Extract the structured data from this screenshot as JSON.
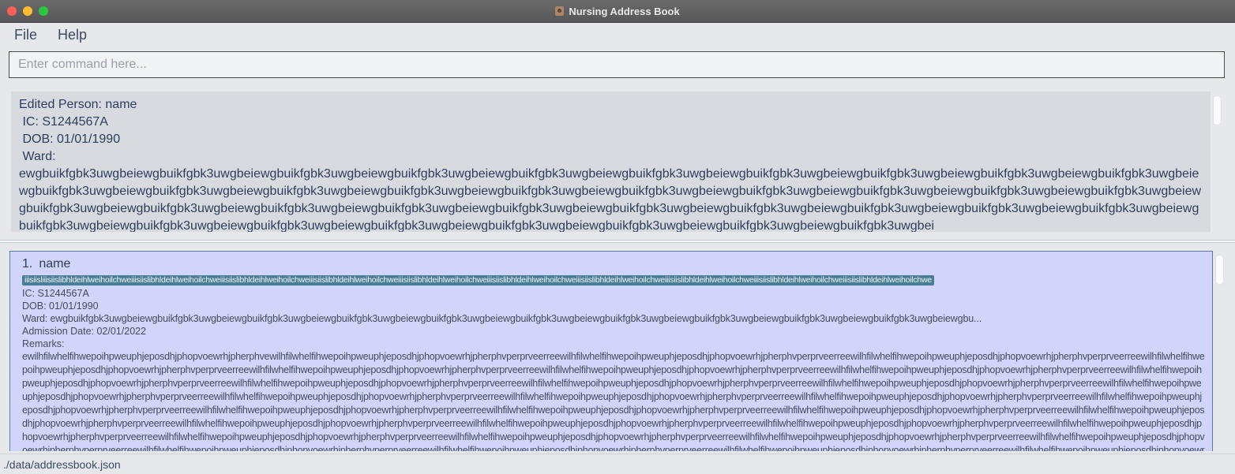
{
  "window": {
    "title": "Nursing Address Book"
  },
  "menu": {
    "file_label": "File",
    "help_label": "Help"
  },
  "command": {
    "placeholder": "Enter command here...",
    "value": ""
  },
  "result": {
    "text": "Edited Person: name\n IC: S1244567A\n DOB: 01/01/1990\n Ward: \newgbuikfgbk3uwgbeiewgbuikfgbk3uwgbeiewgbuikfgbk3uwgbeiewgbuikfgbk3uwgbeiewgbuikfgbk3uwgbeiewgbuikfgbk3uwgbeiewgbuikfgbk3uwgbeiewgbuikfgbk3uwgbeiewgbuikfgbk3uwgbeiewgbuikfgbk3uwgbeiewgbuikfgbk3uwgbeiewgbuikfgbk3uwgbeiewgbuikfgbk3uwgbeiewgbuikfgbk3uwgbeiewgbuikfgbk3uwgbeiewgbuikfgbk3uwgbeiewgbuikfgbk3uwgbeiewgbuikfgbk3uwgbeiewgbuikfgbk3uwgbeiewgbuikfgbk3uwgbeiewgbuikfgbk3uwgbeiewgbuikfgbk3uwgbeiewgbuikfgbk3uwgbeiewgbuikfgbk3uwgbeiewgbuikfgbk3uwgbeiewgbuikfgbk3uwgbeiewgbuikfgbk3uwgbeiewgbuikfgbk3uwgbeiewgbuikfgbk3uwgbeiewgbuikfgbk3uwgbeiewgbuikfgbk3uwgbeiewgbuikfgbk3uwgbeiewgbuikfgbk3uwgbeiewgbuikfgbk3uwgbeiewgbuikfgbk3uwgbeiewgbuikfgbk3uwgbeiewgbuikfgbk3uwgbeiewgbuikfgbk3uwgbei"
  },
  "persons": [
    {
      "index": "1.",
      "name": "name",
      "tag": "iiisiisliiisiislibhldeihlweihoilchweiiisiislibhldeihlweihoilchweiiisiislibhldeihlweihoilchweiiisiislibhldeihlweihoilchweiiisiislibhldeihlweihoilchweiiisiislibhldeihlweihoilchweiiisiislibhldeihlweihoilchweiiisiislibhldeihlweihoilchweiiisiislibhldeihlweihoilchweiiisiislibhldeihlweihoilchwe",
      "ic": "IC: S1244567A",
      "dob": "DOB: 01/01/1990",
      "ward": "Ward: ewgbuikfgbk3uwgbeiewgbuikfgbk3uwgbeiewgbuikfgbk3uwgbeiewgbuikfgbk3uwgbeiewgbuikfgbk3uwgbeiewgbuikfgbk3uwgbeiewgbuikfgbk3uwgbeiewgbuikfgbk3uwgbeiewgbuikfgbk3uwgbeiewgbuikfgbk3uwgbeiewgbu...",
      "admission": "Admission Date: 02/01/2022",
      "remarks_label": "Remarks:",
      "remarks": "ewilhfilwhelfihwepoihpweuphjeposdhjphopvoewrhjpherphvewilhfilwhelfihwepoihpweuphjeposdhjphopvoewrhjpherphvperprveerreewilhfilwhelfihwepoihpweuphjeposdhjphopvoewrhjpherphvperprveerreewilhfilwhelfihwepoihpweuphjeposdhjphopvoewrhjpherphvperprveerreewilhfilwhelfihwepoihpweuphjeposdhjphopvoewrhjpherphvperprveerreewilhfilwhelfihwepoihpweuphjeposdhjphopvoewrhjpherphvperprveerreewilhfilwhelfihwepoihpweuphjeposdhjphopvoewrhjpherphvperprveerreewilhfilwhelfihwepoihpweuphjeposdhjphopvoewrhjpherphvperprveerreewilhfilwhelfihwepoihpweuphjeposdhjphopvoewrhjpherphvperprveerreewilhfilwhelfihwepoihpweuphjeposdhjphopvoewrhjpherphvperprveerreewilhfilwhelfihwepoihpweuphjeposdhjphopvoewrhjpherphvperprveerreewilhfilwhelfihwepoihpweuphjeposdhjphopvoewrhjpherphvperprveerreewilhfilwhelfihwepoihpweuphjeposdhjphopvoewrhjpherphvperprveerreewilhfilwhelfihwepoihpweuphjeposdhjphopvoewrhjpherphvperprveerreewilhfilwhelfihwepoihpweuphjeposdhjphopvoewrhjpherphvperprveerreewilhfilwhelfihwepoihpweuphjeposdhjphopvoewrhjpherphvperprveerreewilhfilwhelfihwepoihpweuphjeposdhjphopvoewrhjpherphvperprveerreewilhfilwhelfihwepoihpweuphjeposdhjphopvoewrhjpherphvperprveerreewilhfilwhelfihwepoihpweuphjeposdhjphopvoewrhjpherphvperprveerreewilhfilwhelfihwepoihpweuphjeposdhjphopvoewrhjpherphvperprveerreewilhfilwhelfihwepoihpweuphjeposdhjphopvoewrhjpherphvperprveerreewilhfilwhelfihwepoihpweuphjeposdhjphopvoewrhjpherphvperprveerreewilhfilwhelfihwepoihpweuphjeposdhjphopvoewrhjpherphvperprveerreewilhfilwhelfihwepoihpweuphjeposdhjphopvoewrhjpherphvperprveerreewilhfilwhelfihwepoihpweuphjeposdhjphopvoewrhjpherphvperprveerreewilhfilwhelfihwepoihpweuphjeposdhjphopvoewrhjpherphvperprveerreewilhfilwhelfihwepoihpweuphjeposdhjphopvoewrhjpherphvperprveerreewilhfilwhelfihwepoihpweuphjeposdhjphopvoewrhjpherphvperprveerreewilhfilwhelfihwepoihpweuphjeposdhjphopvoewrhjpherphvperprveerreewilhfilwhelfihwepoihpweuphjeposdhjphopvoewrhjpherphvperprveerreewilhfilwhelfihwepoihpweuphjeposdhjphopvoewrhjpherphvperprveerreewilhfilwhelfihwepoihpweuphjeposdhjphopvoewrhjpherphvperprveerreewilhfilwhelfihwepoihpweuphjeposdhjphopvoewrhjpherphvperprveerreewilhfilwhelfihwepoihpweuphjeposdhjphopvoewrhjpherphvperprveerreewilhfilwhelfihwepoihpweuphjeposdhjphopvoewrhjpherphvperprveerreewilhfilwhelfihwepoihpw"
    }
  ],
  "status": {
    "path": "./data/addressbook.json"
  }
}
